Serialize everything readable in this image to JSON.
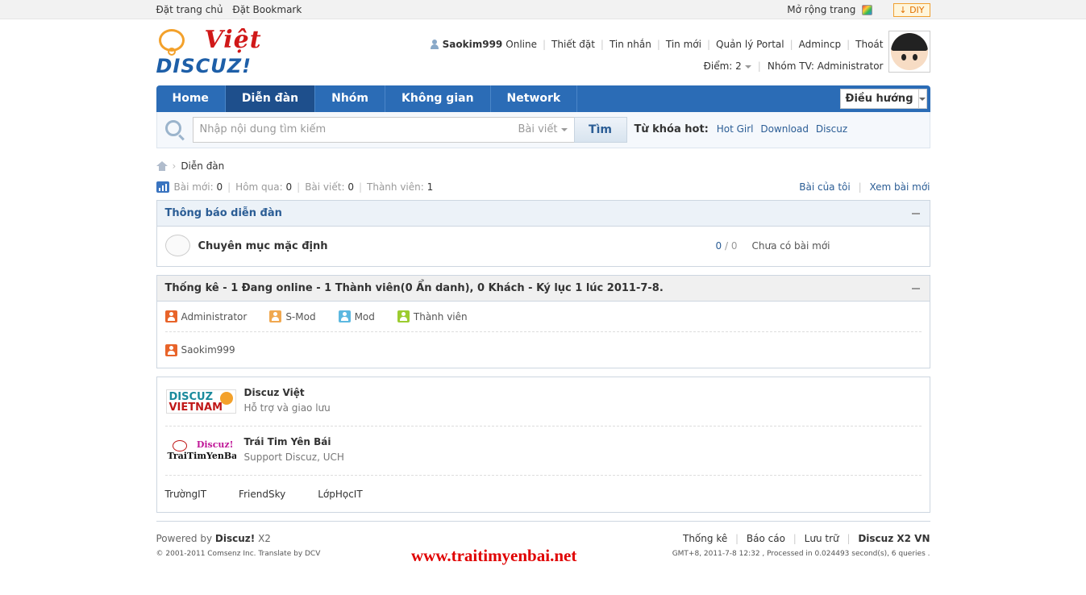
{
  "topbar": {
    "left": [
      "Đặt trang chủ",
      "Đặt Bookmark"
    ],
    "expand": "Mở rộng trang",
    "diy": "DIY"
  },
  "logo": {
    "viet": "Việt",
    "discuz": "DISCUZ!"
  },
  "user": {
    "name": "Saokim999",
    "status": "Online",
    "links": [
      "Thiết đặt",
      "Tin nhắn",
      "Tin mới",
      "Quản lý Portal",
      "Admincp",
      "Thoát"
    ],
    "points": "Điểm: 2",
    "group": "Nhóm TV: Administrator"
  },
  "nav": {
    "items": [
      "Home",
      "Diễn đàn",
      "Nhóm",
      "Không gian",
      "Network"
    ],
    "active": 1,
    "guide": "Điều hướng"
  },
  "search": {
    "placeholder": "Nhập nội dung tìm kiếm",
    "type": "Bài viết",
    "button": "Tìm",
    "hot_label": "Từ khóa hot:",
    "hot": [
      "Hot Girl",
      "Download",
      "Discuz"
    ]
  },
  "breadcrumb": {
    "current": "Diễn đàn"
  },
  "stats": {
    "new_label": "Bài mới:",
    "new": "0",
    "yesterday_label": "Hôm qua:",
    "yesterday": "0",
    "posts_label": "Bài viết:",
    "posts": "0",
    "members_label": "Thành viên:",
    "members": "1",
    "my_posts": "Bài của tôi",
    "view_new": "Xem bài mới"
  },
  "forum_box": {
    "title": "Thông báo diễn đàn",
    "rows": [
      {
        "name": "Chuyên mục mặc định",
        "threads": "0",
        "posts": "0",
        "last": "Chưa có bài mới"
      }
    ]
  },
  "online_box": {
    "title": "Thống kê - 1 Đang online - 1 Thành viên(0 Ẩn danh), 0 Khách - Ký lục 1 lúc 2011-7-8.",
    "legend": [
      {
        "label": "Administrator",
        "color": "#e8642a"
      },
      {
        "label": "S-Mod",
        "color": "#f0a850"
      },
      {
        "label": "Mod",
        "color": "#5cb8e0"
      },
      {
        "label": "Thành viên",
        "color": "#9ccc30"
      }
    ],
    "online_users": [
      "Saokim999"
    ],
    "online_color": "#e8642a"
  },
  "links_box": {
    "image_links": [
      {
        "logo_line1": "DISCUZ",
        "logo_line2": "VIETNAM",
        "title": "Discuz Việt",
        "desc": "Hỗ trợ và giao lưu"
      },
      {
        "logo_line1": "Discuz!",
        "logo_line2": "TraiTimYenBai",
        "title": "Trái Tim Yên Bái",
        "desc": "Support Discuz, UCH"
      }
    ],
    "text_links": [
      "TrườngIT",
      "FriendSky",
      "LớpHọcIT"
    ]
  },
  "footer": {
    "powered": "Powered by",
    "product": "Discuz!",
    "version": "X2",
    "copyright": "© 2001-2011 Comsenz Inc. Translate by DCV",
    "links": [
      "Thống kê",
      "Báo cáo",
      "Lưu trữ"
    ],
    "brand": "Discuz X2 VN",
    "processed": "GMT+8, 2011-7-8 12:32 , Processed in 0.024493 second(s), 6 queries ."
  },
  "watermark": "www.traitimyenbai.net",
  "colors": {
    "nav": "#2b6cb6",
    "nav_active": "#1e4f8c",
    "link": "#2b5d95",
    "watermark": "#e00000"
  }
}
